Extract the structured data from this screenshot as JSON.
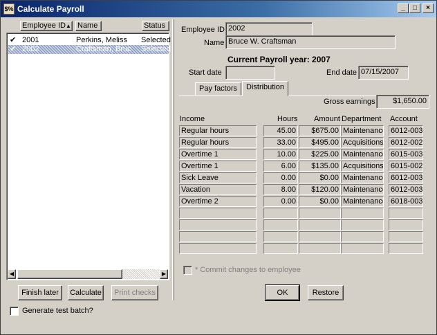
{
  "window": {
    "title": "Calculate Payroll",
    "icon_text": "$%"
  },
  "list": {
    "columns": {
      "employee_id": "Employee ID",
      "name": "Name",
      "status": "Status"
    },
    "rows": [
      {
        "check": "✔",
        "id": "2001",
        "name": "Perkins, Meliss",
        "status": "Selected"
      },
      {
        "check": "✔",
        "id": "2002",
        "name": "Craftsman, Bruc",
        "status": "Selected"
      }
    ]
  },
  "buttons": {
    "finish_later": "Finish later",
    "calculate": "Calculate",
    "print_checks": "Print checks",
    "ok": "OK",
    "restore": "Restore"
  },
  "generate_test_batch": "Generate test batch?",
  "employee": {
    "id_label": "Employee ID",
    "id_value": "2002",
    "name_label": "Name",
    "name_value": "Bruce W. Craftsman"
  },
  "payroll_year": "Current Payroll year: 2007",
  "start_date": {
    "label": "Start date",
    "value": ""
  },
  "end_date": {
    "label": "End date",
    "value": "07/15/2007"
  },
  "tabs": {
    "pay_factors": "Pay factors",
    "distribution": "Distribution"
  },
  "gross_earnings": {
    "label": "Gross earnings",
    "value": "$1,650.00"
  },
  "grid": {
    "headers": {
      "income": "Income",
      "hours": "Hours",
      "amount": "Amount",
      "department": "Department",
      "account": "Account"
    },
    "rows": [
      {
        "income": "Regular hours",
        "hours": "45.00",
        "amount": "$675.00",
        "department": "Maintenance",
        "account": "6012-003"
      },
      {
        "income": "Regular hours",
        "hours": "33.00",
        "amount": "$495.00",
        "department": "Acquisitions",
        "account": "6012-002"
      },
      {
        "income": "Overtime 1",
        "hours": "10.00",
        "amount": "$225.00",
        "department": "Maintenance",
        "account": "6015-003"
      },
      {
        "income": "Overtime 1",
        "hours": "6.00",
        "amount": "$135.00",
        "department": "Acquisitions",
        "account": "6015-002"
      },
      {
        "income": "Sick Leave",
        "hours": "0.00",
        "amount": "$0.00",
        "department": "Maintenance",
        "account": "6012-003"
      },
      {
        "income": "Vacation",
        "hours": "8.00",
        "amount": "$120.00",
        "department": "Maintenance",
        "account": "6012-003"
      },
      {
        "income": "Overtime 2",
        "hours": "0.00",
        "amount": "$0.00",
        "department": "Maintenance",
        "account": "6018-003"
      }
    ],
    "empty_row_count": 4
  },
  "commit_changes": "* Commit changes to employee"
}
